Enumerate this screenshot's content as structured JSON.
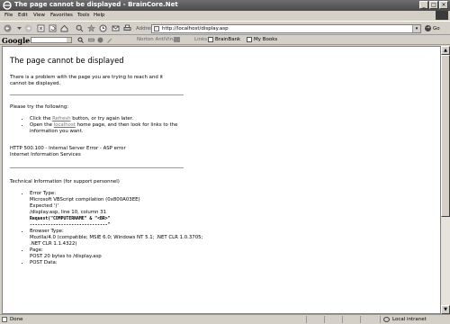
{
  "window": {
    "title": "The page cannot be displayed - BrainCore.Net"
  },
  "menu": [
    "File",
    "Edit",
    "View",
    "Favorites",
    "Tools",
    "Help"
  ],
  "address": {
    "label": "Address",
    "url": "http://localhost/display.asp",
    "go": "Go"
  },
  "links_bar": {
    "google": "Google",
    "norton": "Norton AntiVirus",
    "links": "Links",
    "items": [
      "BrainBank",
      "My Books"
    ]
  },
  "page": {
    "heading": "The page cannot be displayed",
    "intro": "There is a problem with the page you are trying to reach and it cannot be displayed.",
    "try_heading": "Please try the following:",
    "try_items": [
      {
        "pre": "Click the ",
        "link": "Refresh",
        "post": " button, or try again later."
      },
      {
        "pre": "Open the ",
        "link": "localhost",
        "post": " home page, and then look for links to the information you want."
      }
    ],
    "error_line1": "HTTP 500.100 - Internal Server Error - ASP error",
    "error_line2": "Internet Information Services",
    "tech_heading": "Technical Information (for support personnel)",
    "tech": {
      "error_type": {
        "label": "Error Type:",
        "line1": "Microsoft VBScript compilation (0x800A03EE)",
        "line2": "Expected ')'",
        "line3": "/display.asp, line 10, column 31",
        "code": "Request(\"COMPUTERNAME\" & \"<BR>\"",
        "underline": "------------------------------^"
      },
      "browser_type": {
        "label": "Browser Type:",
        "value": "Mozilla/4.0 (compatible; MSIE 6.0; Windows NT 5.1; .NET CLR 1.0.3705; .NET CLR 1.1.4322)"
      },
      "page_info": {
        "label": "Page:",
        "value": "POST 20 bytes to /display.asp"
      },
      "post_data": {
        "label": "POST Data:"
      }
    }
  },
  "status": {
    "text": "Done",
    "zone": "Local intranet"
  }
}
